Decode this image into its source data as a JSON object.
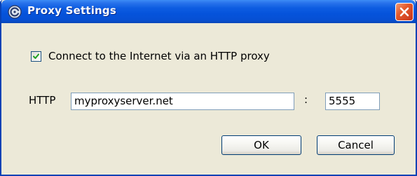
{
  "window": {
    "title": "Proxy Settings",
    "icon": "app-icon",
    "close_icon": "close-icon",
    "colors": {
      "titlebar": "#0553db",
      "background": "#ece9d8",
      "close_button": "#e45a2c"
    }
  },
  "proxy": {
    "enable_label": "Connect to the Internet via an HTTP proxy",
    "enabled": true,
    "http_label": "HTTP",
    "host_value": "myproxyserver.net",
    "separator": ":",
    "port_value": "5555"
  },
  "buttons": {
    "ok_label": "OK",
    "cancel_label": "Cancel"
  }
}
